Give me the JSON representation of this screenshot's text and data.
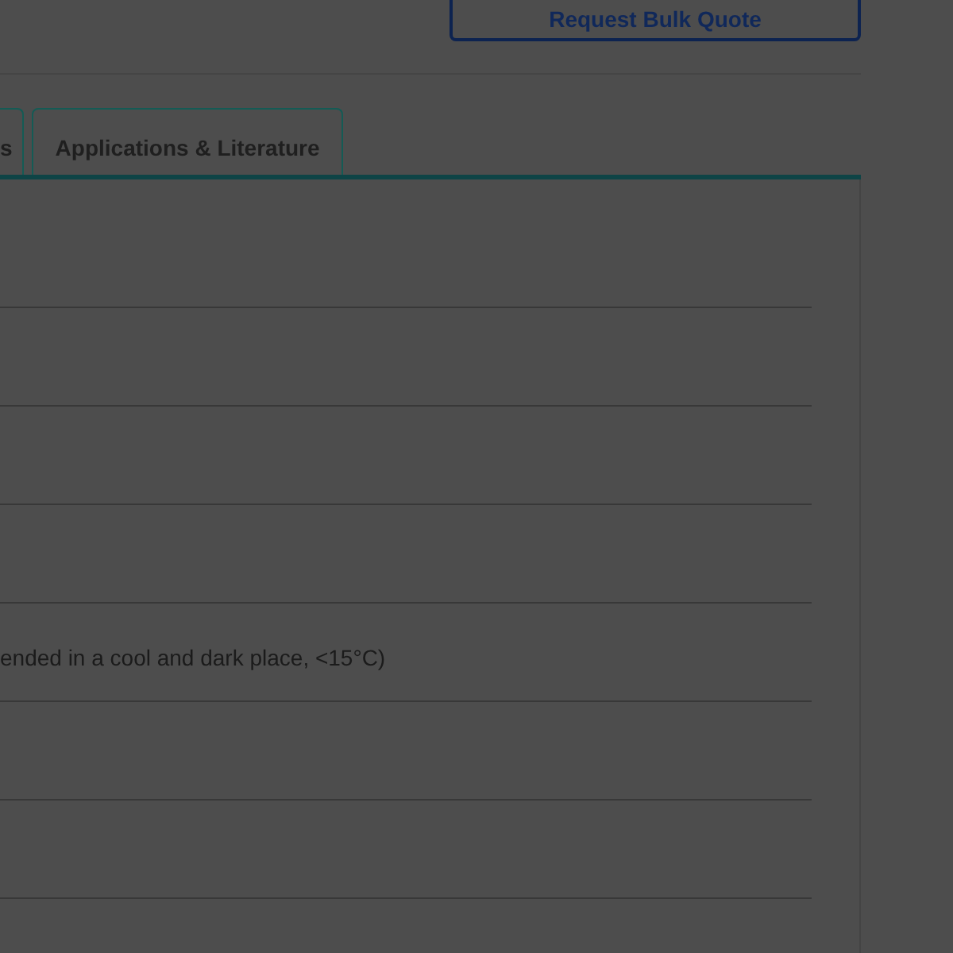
{
  "header": {
    "button": "Request Bulk Quote"
  },
  "tabs": [
    {
      "label": "s",
      "selected": false
    },
    {
      "label": "Applications & Literature",
      "selected": false
    }
  ],
  "table": {
    "rows": [
      {},
      {},
      {},
      {},
      {
        "value": "ended in a cool and dark place, <15°C)"
      },
      {},
      {}
    ]
  }
}
